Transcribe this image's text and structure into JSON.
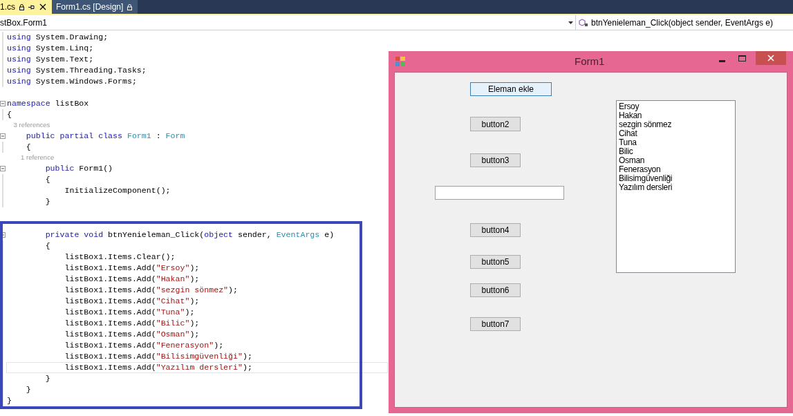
{
  "tabs": [
    {
      "label": "1.cs",
      "selected": true
    },
    {
      "label": "Form1.cs [Design]",
      "selected": false
    }
  ],
  "nav_bar": {
    "type_selector": "stBox.Form1",
    "member_selector": "btnYenieleman_Click(object sender, EventArgs e)"
  },
  "code_lines": [
    {
      "kind": "code",
      "fold": false,
      "current": false,
      "tokens": [
        {
          "kind": "keyword",
          "text": "using"
        },
        {
          "kind": "plain",
          "text": " System.Drawing;"
        }
      ]
    },
    {
      "kind": "code",
      "fold": false,
      "current": false,
      "tokens": [
        {
          "kind": "keyword",
          "text": "using"
        },
        {
          "kind": "plain",
          "text": " System.Linq;"
        }
      ]
    },
    {
      "kind": "code",
      "fold": false,
      "current": false,
      "tokens": [
        {
          "kind": "keyword",
          "text": "using"
        },
        {
          "kind": "plain",
          "text": " System.Text;"
        }
      ]
    },
    {
      "kind": "code",
      "fold": false,
      "current": false,
      "tokens": [
        {
          "kind": "keyword",
          "text": "using"
        },
        {
          "kind": "plain",
          "text": " System.Threading.Tasks;"
        }
      ]
    },
    {
      "kind": "code",
      "fold": false,
      "current": false,
      "tokens": [
        {
          "kind": "keyword",
          "text": "using"
        },
        {
          "kind": "plain",
          "text": " System.Windows.Forms;"
        }
      ]
    },
    {
      "kind": "blank"
    },
    {
      "kind": "code",
      "fold": true,
      "current": false,
      "tokens": [
        {
          "kind": "keyword",
          "text": "namespace"
        },
        {
          "kind": "plain",
          "text": " listBox"
        }
      ]
    },
    {
      "kind": "code",
      "fold": false,
      "current": false,
      "tokens": [
        {
          "kind": "plain",
          "text": "{"
        }
      ]
    },
    {
      "kind": "lens",
      "text": "    3 references"
    },
    {
      "kind": "code",
      "fold": true,
      "current": false,
      "tokens": [
        {
          "kind": "keyword",
          "text": "    public partial class"
        },
        {
          "kind": "type",
          "text": " Form1"
        },
        {
          "kind": "plain",
          "text": " : "
        },
        {
          "kind": "type",
          "text": "Form"
        }
      ]
    },
    {
      "kind": "code",
      "fold": false,
      "current": false,
      "tokens": [
        {
          "kind": "plain",
          "text": "    {"
        }
      ]
    },
    {
      "kind": "lens",
      "text": "        1 reference"
    },
    {
      "kind": "code",
      "fold": true,
      "current": false,
      "tokens": [
        {
          "kind": "keyword",
          "text": "        public"
        },
        {
          "kind": "plain",
          "text": " Form1()"
        }
      ]
    },
    {
      "kind": "code",
      "fold": false,
      "current": false,
      "tokens": [
        {
          "kind": "plain",
          "text": "        {"
        }
      ]
    },
    {
      "kind": "code",
      "fold": false,
      "current": false,
      "tokens": [
        {
          "kind": "plain",
          "text": "            InitializeComponent();"
        }
      ]
    },
    {
      "kind": "code",
      "fold": false,
      "current": false,
      "tokens": [
        {
          "kind": "plain",
          "text": "        }"
        }
      ]
    },
    {
      "kind": "blank"
    },
    {
      "kind": "blank"
    },
    {
      "kind": "code",
      "fold": true,
      "current": false,
      "tokens": [
        {
          "kind": "keyword",
          "text": "        private void"
        },
        {
          "kind": "plain",
          "text": " btnYenieleman_Click("
        },
        {
          "kind": "keyword",
          "text": "object"
        },
        {
          "kind": "plain",
          "text": " sender, "
        },
        {
          "kind": "type",
          "text": "EventArgs"
        },
        {
          "kind": "plain",
          "text": " e)"
        }
      ]
    },
    {
      "kind": "code",
      "fold": false,
      "current": false,
      "tokens": [
        {
          "kind": "plain",
          "text": "        {"
        }
      ]
    },
    {
      "kind": "code",
      "fold": false,
      "current": false,
      "tokens": [
        {
          "kind": "plain",
          "text": "            listBox1.Items.Clear();"
        }
      ]
    },
    {
      "kind": "code",
      "fold": false,
      "current": false,
      "tokens": [
        {
          "kind": "plain",
          "text": "            listBox1.Items.Add("
        },
        {
          "kind": "string",
          "text": "\"Ersoy\""
        },
        {
          "kind": "plain",
          "text": ");"
        }
      ]
    },
    {
      "kind": "code",
      "fold": false,
      "current": false,
      "tokens": [
        {
          "kind": "plain",
          "text": "            listBox1.Items.Add("
        },
        {
          "kind": "string",
          "text": "\"Hakan\""
        },
        {
          "kind": "plain",
          "text": ");"
        }
      ]
    },
    {
      "kind": "code",
      "fold": false,
      "current": false,
      "tokens": [
        {
          "kind": "plain",
          "text": "            listBox1.Items.Add("
        },
        {
          "kind": "string",
          "text": "\"sezgin sönmez\""
        },
        {
          "kind": "plain",
          "text": ");"
        }
      ]
    },
    {
      "kind": "code",
      "fold": false,
      "current": false,
      "tokens": [
        {
          "kind": "plain",
          "text": "            listBox1.Items.Add("
        },
        {
          "kind": "string",
          "text": "\"Cihat\""
        },
        {
          "kind": "plain",
          "text": ");"
        }
      ]
    },
    {
      "kind": "code",
      "fold": false,
      "current": false,
      "tokens": [
        {
          "kind": "plain",
          "text": "            listBox1.Items.Add("
        },
        {
          "kind": "string",
          "text": "\"Tuna\""
        },
        {
          "kind": "plain",
          "text": ");"
        }
      ]
    },
    {
      "kind": "code",
      "fold": false,
      "current": false,
      "tokens": [
        {
          "kind": "plain",
          "text": "            listBox1.Items.Add("
        },
        {
          "kind": "string",
          "text": "\"Bilic\""
        },
        {
          "kind": "plain",
          "text": ");"
        }
      ]
    },
    {
      "kind": "code",
      "fold": false,
      "current": false,
      "tokens": [
        {
          "kind": "plain",
          "text": "            listBox1.Items.Add("
        },
        {
          "kind": "string",
          "text": "\"Osman\""
        },
        {
          "kind": "plain",
          "text": ");"
        }
      ]
    },
    {
      "kind": "code",
      "fold": false,
      "current": false,
      "tokens": [
        {
          "kind": "plain",
          "text": "            listBox1.Items.Add("
        },
        {
          "kind": "string",
          "text": "\"Fenerasyon\""
        },
        {
          "kind": "plain",
          "text": ");"
        }
      ]
    },
    {
      "kind": "code",
      "fold": false,
      "current": false,
      "tokens": [
        {
          "kind": "plain",
          "text": "            listBox1.Items.Add("
        },
        {
          "kind": "string",
          "text": "\"Bilisimgüvenliği\""
        },
        {
          "kind": "plain",
          "text": ");"
        }
      ]
    },
    {
      "kind": "code",
      "fold": false,
      "current": true,
      "tokens": [
        {
          "kind": "plain",
          "text": "            listBox1.Items.Add("
        },
        {
          "kind": "string",
          "text": "\"Yazılım dersleri\""
        },
        {
          "kind": "plain",
          "text": ");"
        }
      ]
    },
    {
      "kind": "code",
      "fold": false,
      "current": false,
      "tokens": [
        {
          "kind": "plain",
          "text": "        }"
        }
      ]
    },
    {
      "kind": "code",
      "fold": false,
      "current": false,
      "tokens": [
        {
          "kind": "plain",
          "text": "    }"
        }
      ]
    },
    {
      "kind": "code",
      "fold": false,
      "current": false,
      "tokens": [
        {
          "kind": "plain",
          "text": "}"
        }
      ]
    }
  ],
  "form": {
    "title": "Form1",
    "controls": [
      {
        "kind": "button",
        "label": "Eleman ekle",
        "hot": true
      },
      {
        "kind": "button",
        "label": "button2",
        "hot": false
      },
      {
        "kind": "button",
        "label": "button3",
        "hot": false
      },
      {
        "kind": "textbox"
      },
      {
        "kind": "button",
        "label": "button4",
        "hot": false
      },
      {
        "kind": "button",
        "label": "button5",
        "hot": false
      },
      {
        "kind": "button",
        "label": "button6",
        "hot": false
      },
      {
        "kind": "button",
        "label": "button7",
        "hot": false
      },
      {
        "kind": "listbox",
        "items": [
          "Ersoy",
          "Hakan",
          "sezgin sönmez",
          "Cihat",
          "Tuna",
          "Bilic",
          "Osman",
          "Fenerasyon",
          "Bilisimgüvenliği",
          "Yazılım dersleri"
        ]
      }
    ]
  }
}
